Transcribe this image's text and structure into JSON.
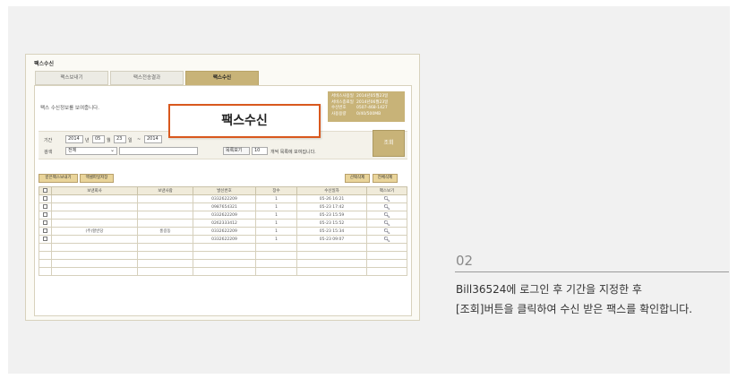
{
  "window": {
    "title": "팩스수신",
    "tabs": [
      "팩스보내기",
      "팩스전송결과",
      "팩스수신"
    ],
    "info_text": "팩스 수신정보를 보여줍니다.",
    "info_box": [
      {
        "k": "서비스사용일",
        "v": "2014년05월23일"
      },
      {
        "k": "서비스종료일",
        "v": "2014년06월23일"
      },
      {
        "k": "수신번호",
        "v": "0507-468-1427"
      },
      {
        "k": "사용용량",
        "v": "0/40/500MB"
      }
    ],
    "search": {
      "period_label": "기간",
      "from_year": "2014",
      "year_unit": "년",
      "from_month": "05",
      "month_unit": "월",
      "from_day": "23",
      "day_unit": "일",
      "tilde": "~",
      "to_year": "2014",
      "keyword_label": "검색",
      "keyword_select": "전체",
      "list_label": "목록보기",
      "list_count": "10",
      "list_suffix": "개씩 목록에 보여집니다.",
      "submit": "조회"
    },
    "buttons": {
      "received_send": "받은팩스보내기",
      "excel_save": "엑셀파일저장",
      "delete_selected": "선택삭제",
      "delete_all": "전체삭제"
    },
    "columns": [
      "",
      "보낸회사",
      "보낸사람",
      "발신번호",
      "장수",
      "수신일자",
      "팩스보기"
    ],
    "rows": [
      {
        "company": "",
        "person": "",
        "number": "0332622209",
        "pages": "1",
        "date": "05-26 16:21"
      },
      {
        "company": "",
        "person": "",
        "number": "0987654321",
        "pages": "1",
        "date": "05-23 17:42"
      },
      {
        "company": "",
        "person": "",
        "number": "0332622209",
        "pages": "1",
        "date": "05-23 15:59"
      },
      {
        "company": "",
        "person": "",
        "number": "0262333412",
        "pages": "1",
        "date": "05-23 15:52"
      },
      {
        "company": "(주)할빈당",
        "person": "홍길동",
        "number": "0332622209",
        "pages": "1",
        "date": "05-23 15:34"
      },
      {
        "company": "",
        "person": "",
        "number": "0332622209",
        "pages": "1",
        "date": "05-23 09:07"
      }
    ],
    "empty_rows": 4
  },
  "callout": "팩스수신",
  "step": {
    "number": "02",
    "line1": "Bill36524에 로그인 후 기간을 지정한 후",
    "line2": "[조회]버튼을 클릭하여 수신 받은 팩스를 확인합니다."
  },
  "colors": {
    "accent": "#c8b378",
    "callout_border": "#d9581d"
  }
}
